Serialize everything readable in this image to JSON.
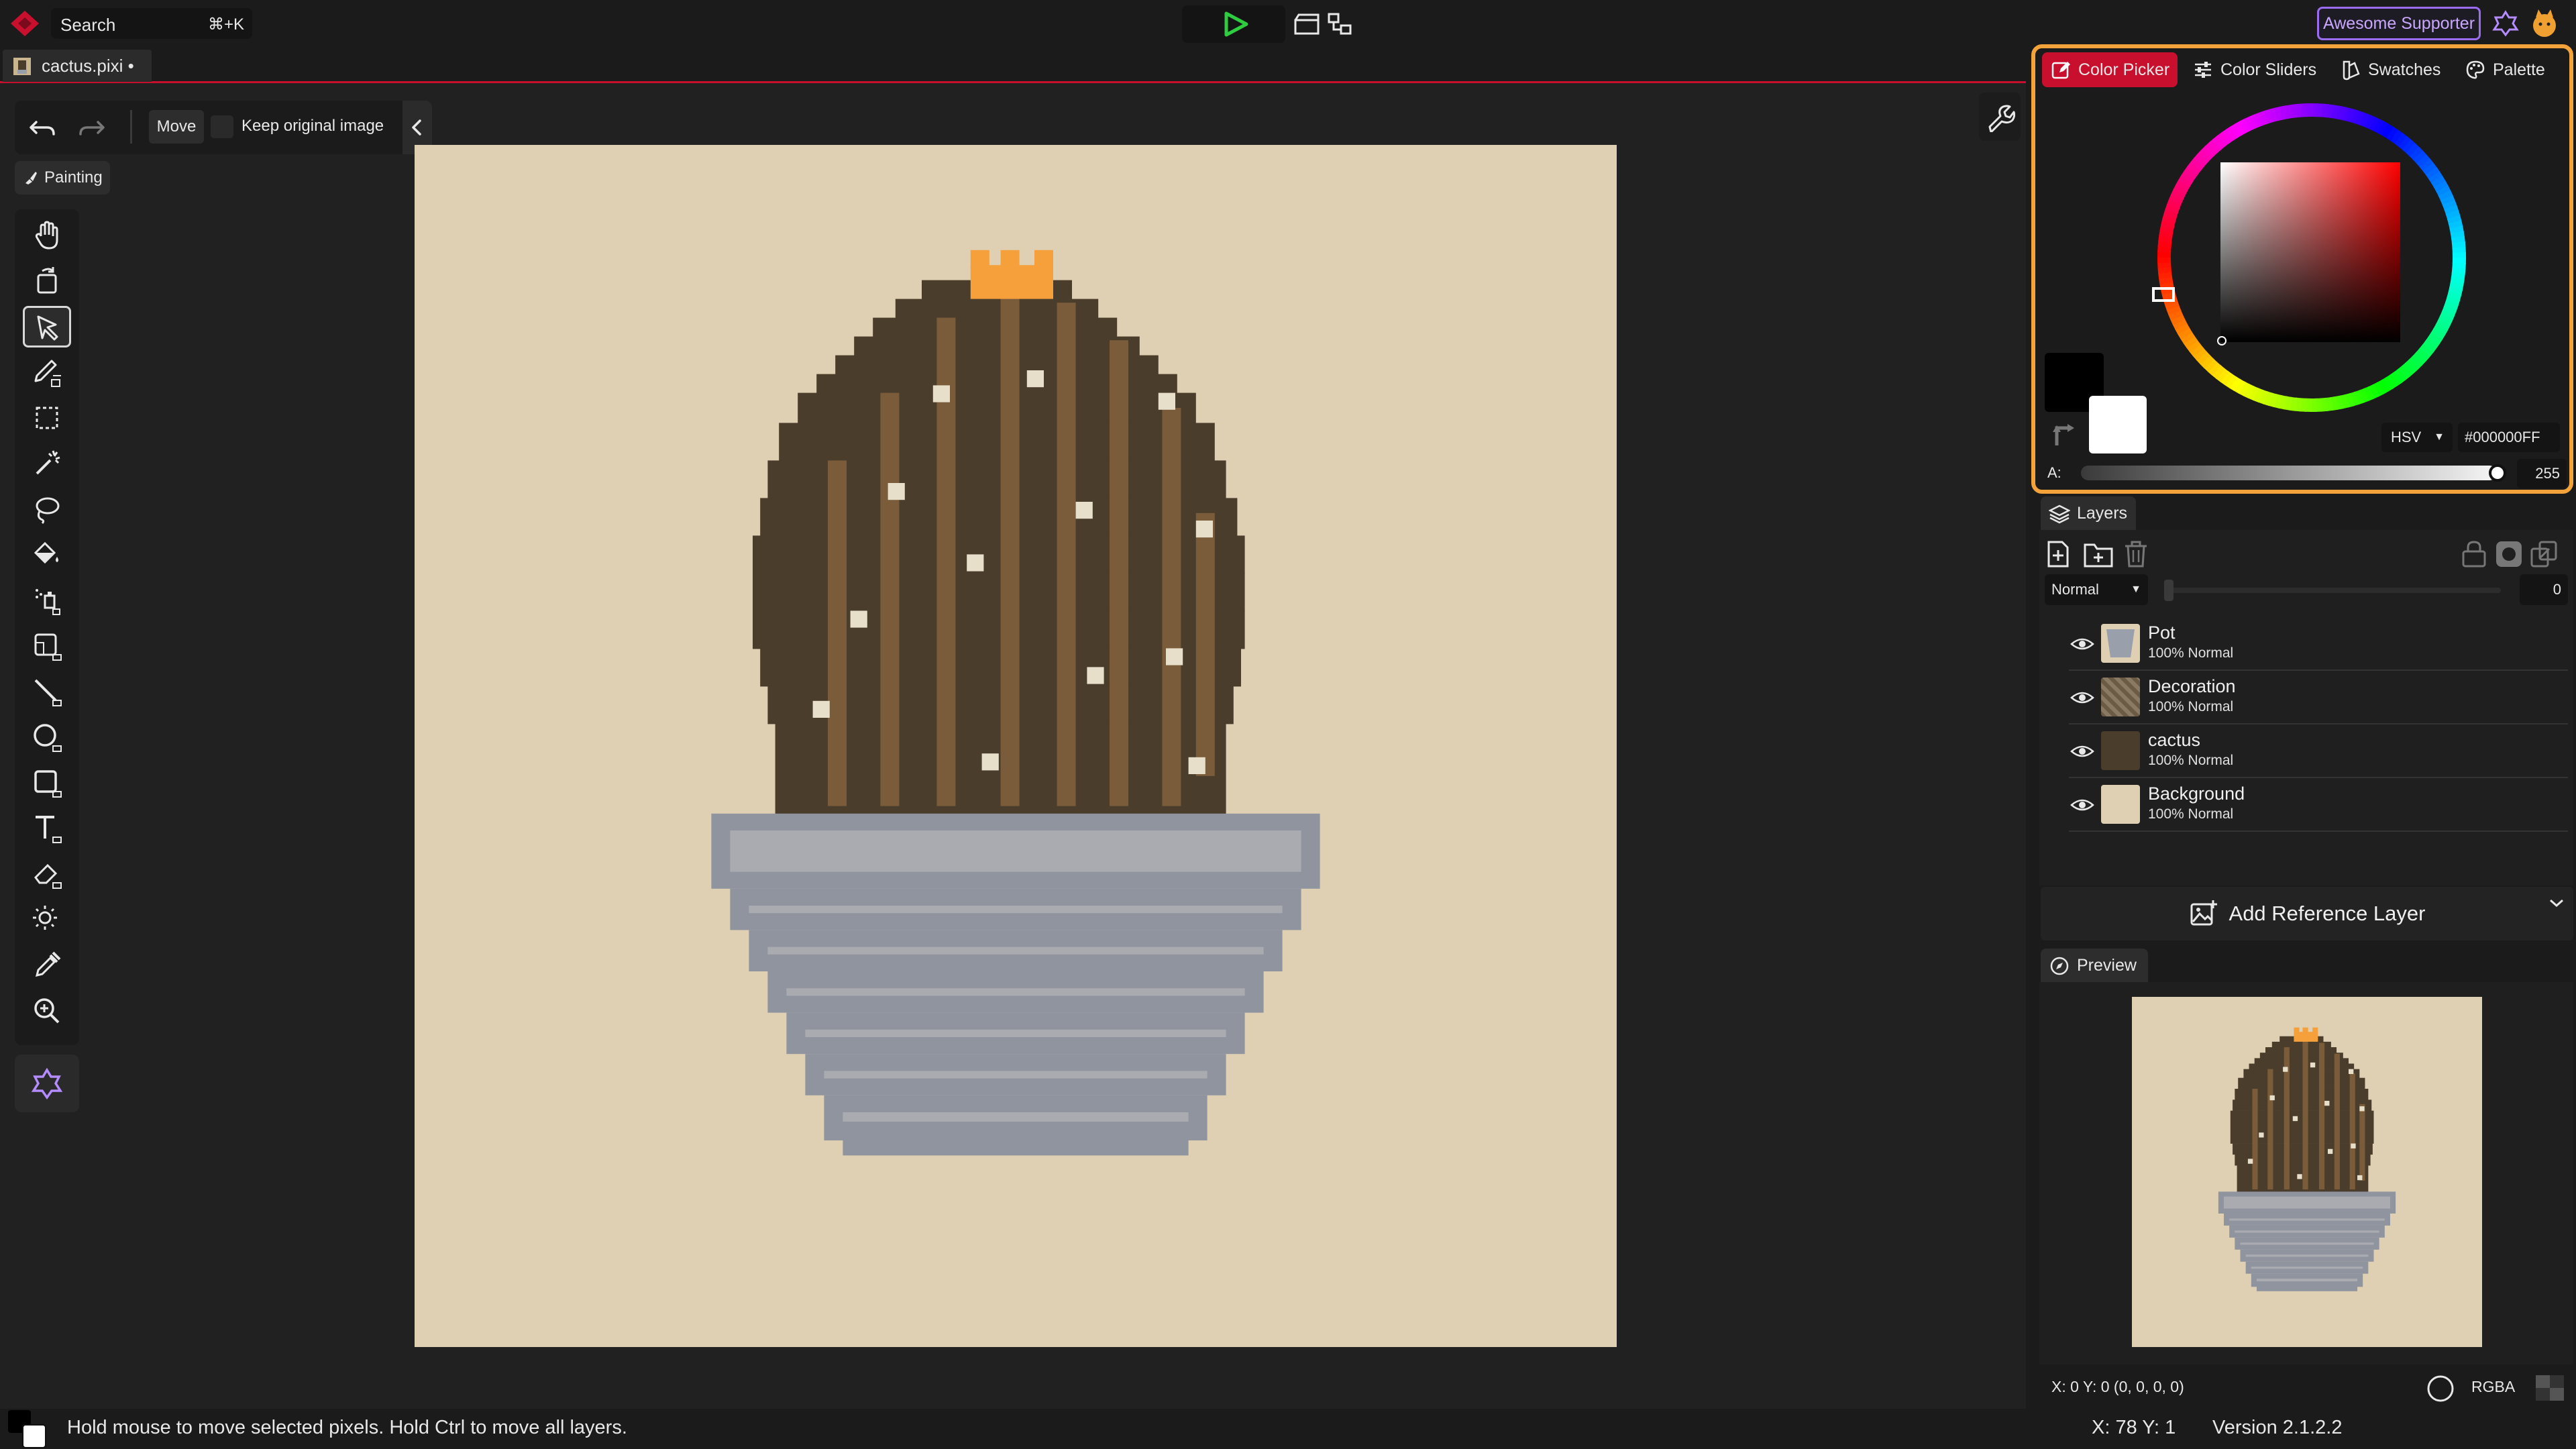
{
  "topbar": {
    "search_label": "Search",
    "search_shortcut": "⌘+K",
    "supporter_label": "Awesome Supporter"
  },
  "file_tab": {
    "title": "cactus.pixi •"
  },
  "tool_options": {
    "move_label": "Move",
    "keep_original_label": "Keep original image"
  },
  "toolset": {
    "label": "Painting"
  },
  "tools": [
    "move-viewport",
    "rotate-viewport",
    "move",
    "pen",
    "rectangle-select",
    "magic-wand",
    "lasso",
    "fill",
    "spray",
    "blur",
    "line",
    "ellipse",
    "rectangle",
    "text",
    "eraser",
    "brightness",
    "color-picker",
    "zoom"
  ],
  "color_panel": {
    "tabs": [
      "Color Picker",
      "Color Sliders",
      "Swatches",
      "Palette"
    ],
    "active_tab": "Color Picker",
    "mode": "HSV",
    "hex": "#000000FF",
    "alpha_label": "A:",
    "alpha_value": "255",
    "primary_color": "#000000",
    "secondary_color": "#ffffff"
  },
  "layers_panel": {
    "tab_label": "Layers",
    "blend_mode": "Normal",
    "opacity_value": "0",
    "layers": [
      {
        "name": "Pot",
        "meta": "100%  Normal",
        "thumb_color": "#9aa0ab"
      },
      {
        "name": "Decoration",
        "meta": "100%  Normal",
        "thumb_color": "#6b5a44"
      },
      {
        "name": "cactus",
        "meta": "100%  Normal",
        "thumb_color": "#4a3d2c"
      },
      {
        "name": "Background",
        "meta": "100%  Normal",
        "thumb_color": "#dfd0b3"
      }
    ],
    "add_reference_label": "Add Reference Layer"
  },
  "preview_panel": {
    "tab_label": "Preview"
  },
  "bottom_info": {
    "pixel_info": "X: 0 Y: 0   (0, 0, 0, 0)",
    "color_mode": "RGBA"
  },
  "status": {
    "hint": "Hold mouse to move selected pixels. Hold Ctrl to move all layers.",
    "cursor": "X: 78 Y: 1",
    "version": "Version 2.1.2.2"
  },
  "colors": {
    "accent": "#c8102e",
    "highlight": "#f3a33a",
    "canvas_bg": "#dfd0b3",
    "cactus_dark": "#4a3d2c",
    "cactus_stripe": "#7a5c3a",
    "pot_light": "#a9abb0",
    "pot_dark": "#8f949f",
    "flower": "#f5a03a",
    "dots": "#e8dfca"
  }
}
